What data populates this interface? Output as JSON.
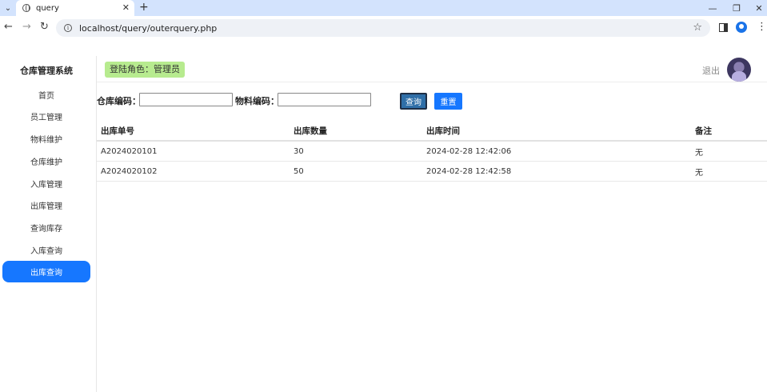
{
  "browser": {
    "tab_title": "query",
    "url": "localhost/query/outerquery.php",
    "icons": {
      "tab_menu": "chevron-down-icon",
      "favicon": "globe-icon",
      "tab_close": "close-icon",
      "new_tab": "plus-icon",
      "minimize": "minimize-icon",
      "restore": "restore-icon",
      "window_close": "close-icon",
      "back": "arrow-left-icon",
      "forward": "arrow-right-icon",
      "reload": "reload-icon",
      "site_info": "info-icon",
      "bookmark": "star-icon",
      "side_panel": "side-panel-icon",
      "profile": "profile-icon",
      "menu": "kebab-icon"
    }
  },
  "sidebar": {
    "brand": "仓库管理系统",
    "items": [
      {
        "label": "首页",
        "active": false
      },
      {
        "label": "员工管理",
        "active": false
      },
      {
        "label": "物料维护",
        "active": false
      },
      {
        "label": "仓库维护",
        "active": false
      },
      {
        "label": "入库管理",
        "active": false
      },
      {
        "label": "出库管理",
        "active": false
      },
      {
        "label": "查询库存",
        "active": false
      },
      {
        "label": "入库查询",
        "active": false
      },
      {
        "label": "出库查询",
        "active": true
      }
    ],
    "active_color": "#1677ff"
  },
  "header": {
    "role_label": "登陆角色：管理员",
    "role_color": "#b7eb8f",
    "logout_label": "退出"
  },
  "search": {
    "warehouse_label": "仓库编码：",
    "warehouse_value": "",
    "material_label": "物料编码：",
    "material_value": "",
    "query_label": "查询",
    "reset_label": "重置"
  },
  "table": {
    "columns": [
      "出库单号",
      "出库数量",
      "出库时间",
      "备注"
    ],
    "rows": [
      [
        "A2024020101",
        "30",
        "2024-02-28 12:42:06",
        "无"
      ],
      [
        "A2024020102",
        "50",
        "2024-02-28 12:42:58",
        "无"
      ]
    ]
  }
}
